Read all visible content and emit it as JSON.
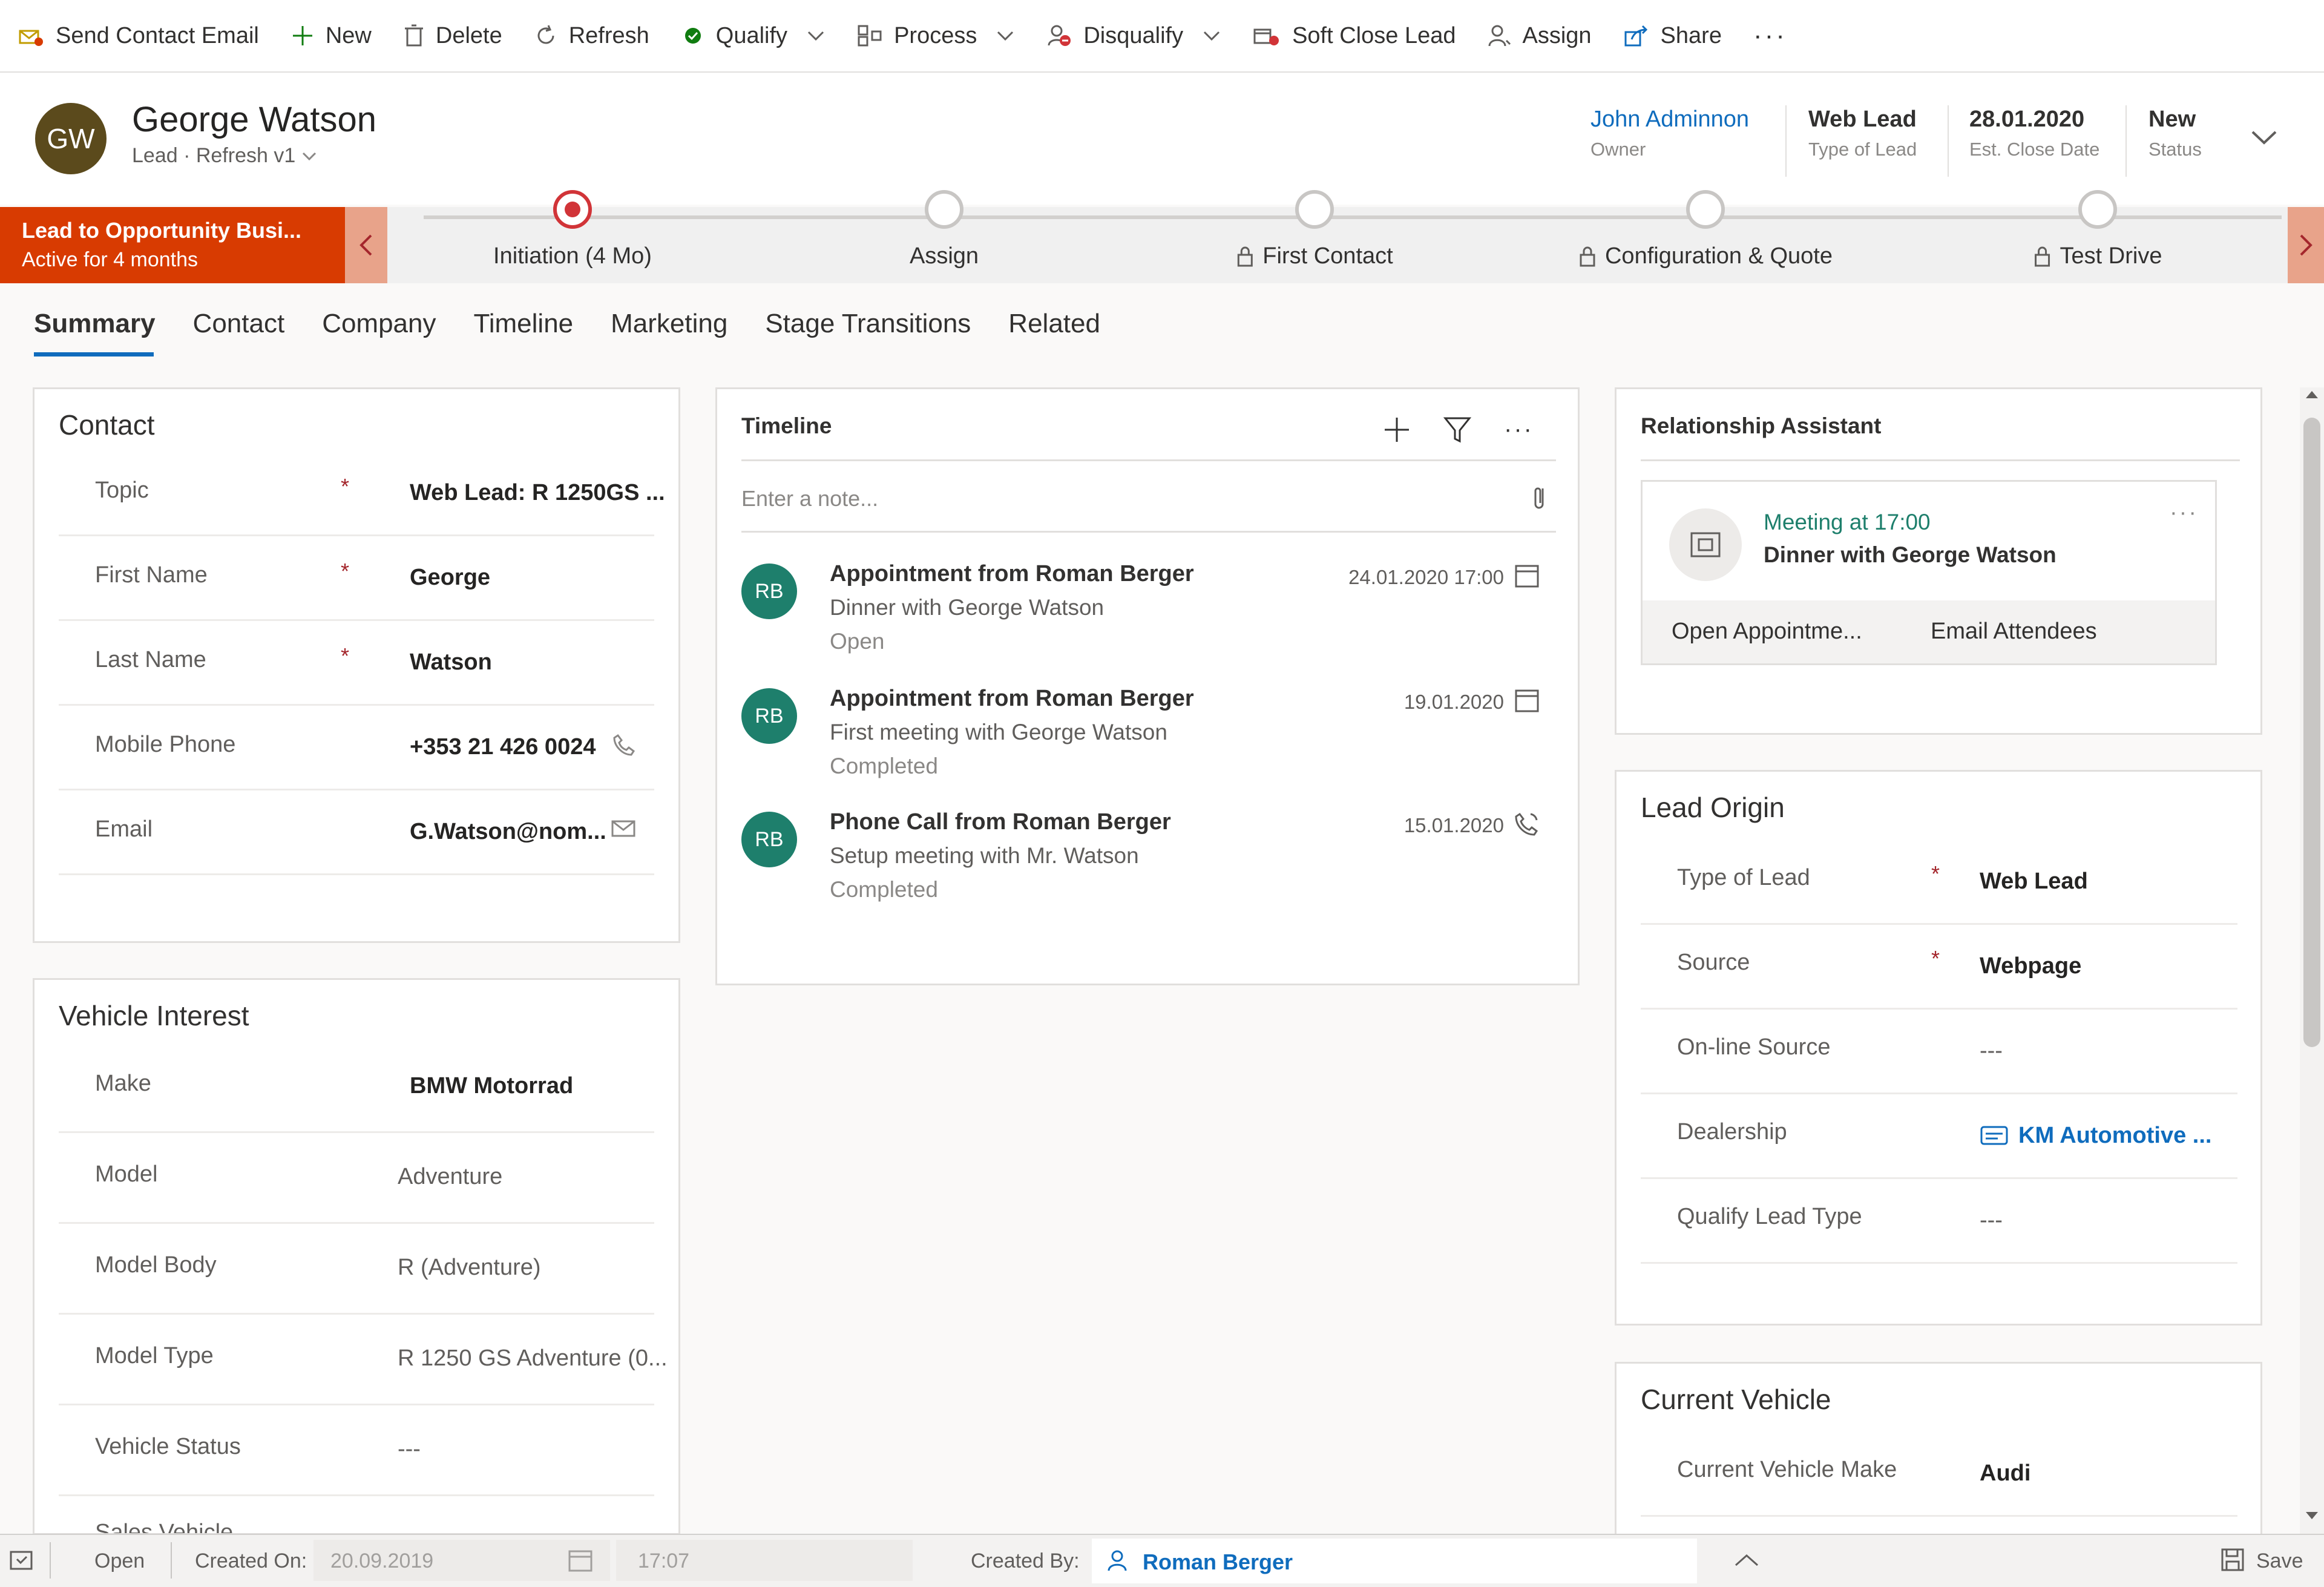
{
  "toolbar": {
    "send_email": "Send Contact Email",
    "new": "New",
    "delete": "Delete",
    "refresh": "Refresh",
    "qualify": "Qualify",
    "process": "Process",
    "disqualify": "Disqualify",
    "soft_close": "Soft Close Lead",
    "assign": "Assign",
    "share": "Share",
    "more": "···"
  },
  "header": {
    "initials": "GW",
    "name": "George Watson",
    "subtitle": "Lead · Refresh v1",
    "owner_value": "John Adminnon",
    "owner_label": "Owner",
    "type_value": "Web Lead",
    "type_label": "Type of Lead",
    "close_value": "28.01.2020",
    "close_label": "Est. Close Date",
    "status_value": "New",
    "status_label": "Status"
  },
  "bpf": {
    "active_title": "Lead to Opportunity Busi...",
    "active_sub": "Active for 4 months",
    "stages": [
      {
        "label": "Initiation  (4 Mo)",
        "state": "active"
      },
      {
        "label": "Assign",
        "state": "open"
      },
      {
        "label": "First Contact",
        "state": "locked"
      },
      {
        "label": "Configuration & Quote",
        "state": "locked"
      },
      {
        "label": "Test Drive",
        "state": "locked"
      }
    ]
  },
  "tabs": [
    "Summary",
    "Contact",
    "Company",
    "Timeline",
    "Marketing",
    "Stage Transitions",
    "Related"
  ],
  "contact": {
    "title": "Contact",
    "fields": [
      {
        "label": "Topic",
        "value": "Web Lead: R 1250GS ...",
        "required": "*"
      },
      {
        "label": "First Name",
        "value": "George",
        "required": "*"
      },
      {
        "label": "Last Name",
        "value": "Watson",
        "required": "*"
      },
      {
        "label": "Mobile Phone",
        "value": "+353 21 426 0024",
        "required": ""
      },
      {
        "label": "Email",
        "value": "G.Watson@nom...",
        "required": ""
      }
    ]
  },
  "vehicle": {
    "title": "Vehicle Interest",
    "fields": [
      {
        "label": "Make",
        "value": "BMW Motorrad"
      },
      {
        "label": "Model",
        "value": "Adventure"
      },
      {
        "label": "Model Body",
        "value": "R (Adventure)"
      },
      {
        "label": "Model Type",
        "value": "R 1250 GS Adventure (0..."
      },
      {
        "label": "Vehicle Status",
        "value": "---"
      },
      {
        "label": "Sales Vehicle",
        "value": "---"
      }
    ]
  },
  "timeline": {
    "title": "Timeline",
    "note_placeholder": "Enter a note...",
    "items": [
      {
        "initials": "RB",
        "title": "Appointment from Roman Berger",
        "desc": "Dinner with George Watson",
        "status": "Open",
        "date": "24.01.2020 17:00"
      },
      {
        "initials": "RB",
        "title": "Appointment from Roman Berger",
        "desc": "First meeting with George Watson",
        "status": "Completed",
        "date": "19.01.2020"
      },
      {
        "initials": "RB",
        "title": "Phone Call from Roman Berger",
        "desc": "Setup meeting with Mr. Watson",
        "status": "Completed",
        "date": "15.01.2020"
      }
    ]
  },
  "assistant": {
    "title": "Relationship Assistant",
    "meeting": "Meeting at 17:00",
    "meeting_desc": "Dinner with George Watson",
    "action_open": "Open Appointme...",
    "action_email": "Email Attendees",
    "more": "···"
  },
  "origin": {
    "title": "Lead Origin",
    "fields": [
      {
        "label": "Type of Lead",
        "value": "Web Lead",
        "required": "*"
      },
      {
        "label": "Source",
        "value": "Webpage",
        "required": "*"
      },
      {
        "label": "On-line Source",
        "value": "---",
        "required": ""
      },
      {
        "label": "Dealership",
        "value": "KM Automotive ...",
        "required": ""
      },
      {
        "label": "Qualify Lead Type",
        "value": "---",
        "required": ""
      }
    ]
  },
  "current_vehicle": {
    "title": "Current Vehicle",
    "make_label": "Current Vehicle Make",
    "make_value": "Audi"
  },
  "statusbar": {
    "status": "Open",
    "created_on_label": "Created On:",
    "created_on_value": "20.09.2019",
    "time_value": "17:07",
    "created_by_label": "Created By:",
    "created_by_value": "Roman Berger",
    "save": "Save"
  },
  "colors": {
    "accent": "#0f6cbd",
    "bpf_active": "#d83b01",
    "stage_active": "#d13438",
    "timeline_avatar": "#1e7f6c"
  }
}
